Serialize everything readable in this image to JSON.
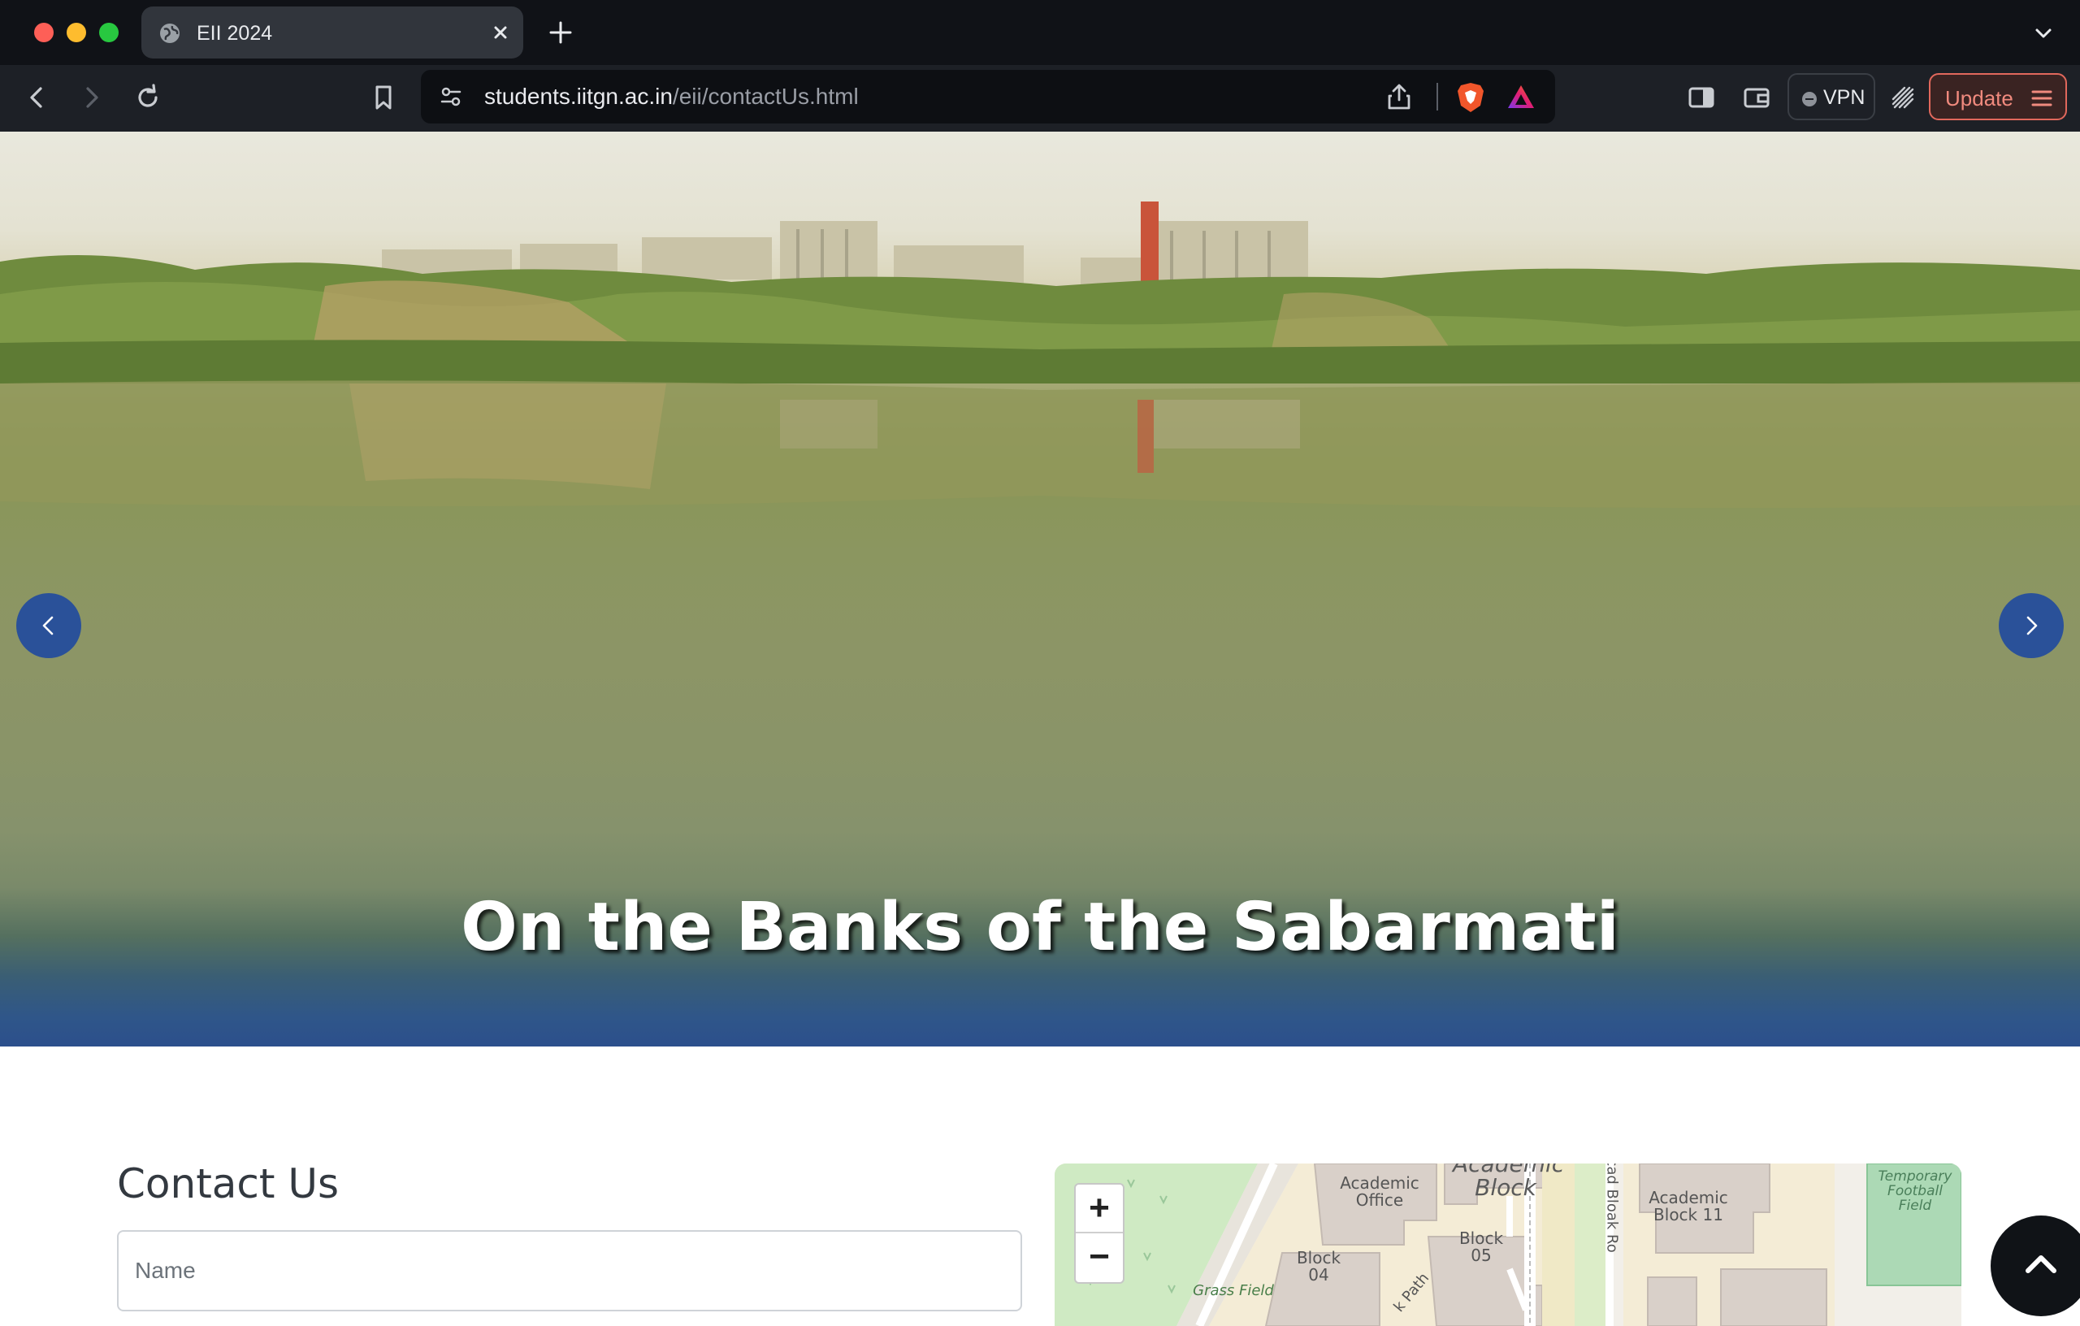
{
  "browser": {
    "tab_title": "EII 2024",
    "url_host": "students.iitgn.ac.in",
    "url_path": "/eii/contactUs.html",
    "vpn_label": "VPN",
    "update_label": "Update"
  },
  "hero": {
    "caption": "On the Banks of the Sabarmati"
  },
  "contact": {
    "title": "Contact Us",
    "name_placeholder": "Name"
  },
  "map": {
    "zoom_in": "+",
    "zoom_out": "−",
    "labels": {
      "academic_office": "Academic Office",
      "academic_block": "Academic Block",
      "block04": "Block 04",
      "block05": "Block 05",
      "academic_block_11": "Academic Block 11",
      "temporary_football_field": "Temporary Football Field",
      "grass_field": "Grass Field",
      "acad_block_road": "Acad Bloak Ro",
      "park_path": "k Path"
    }
  },
  "colors": {
    "brand_blue": "#2a5199",
    "update_accent": "#e2685c"
  }
}
